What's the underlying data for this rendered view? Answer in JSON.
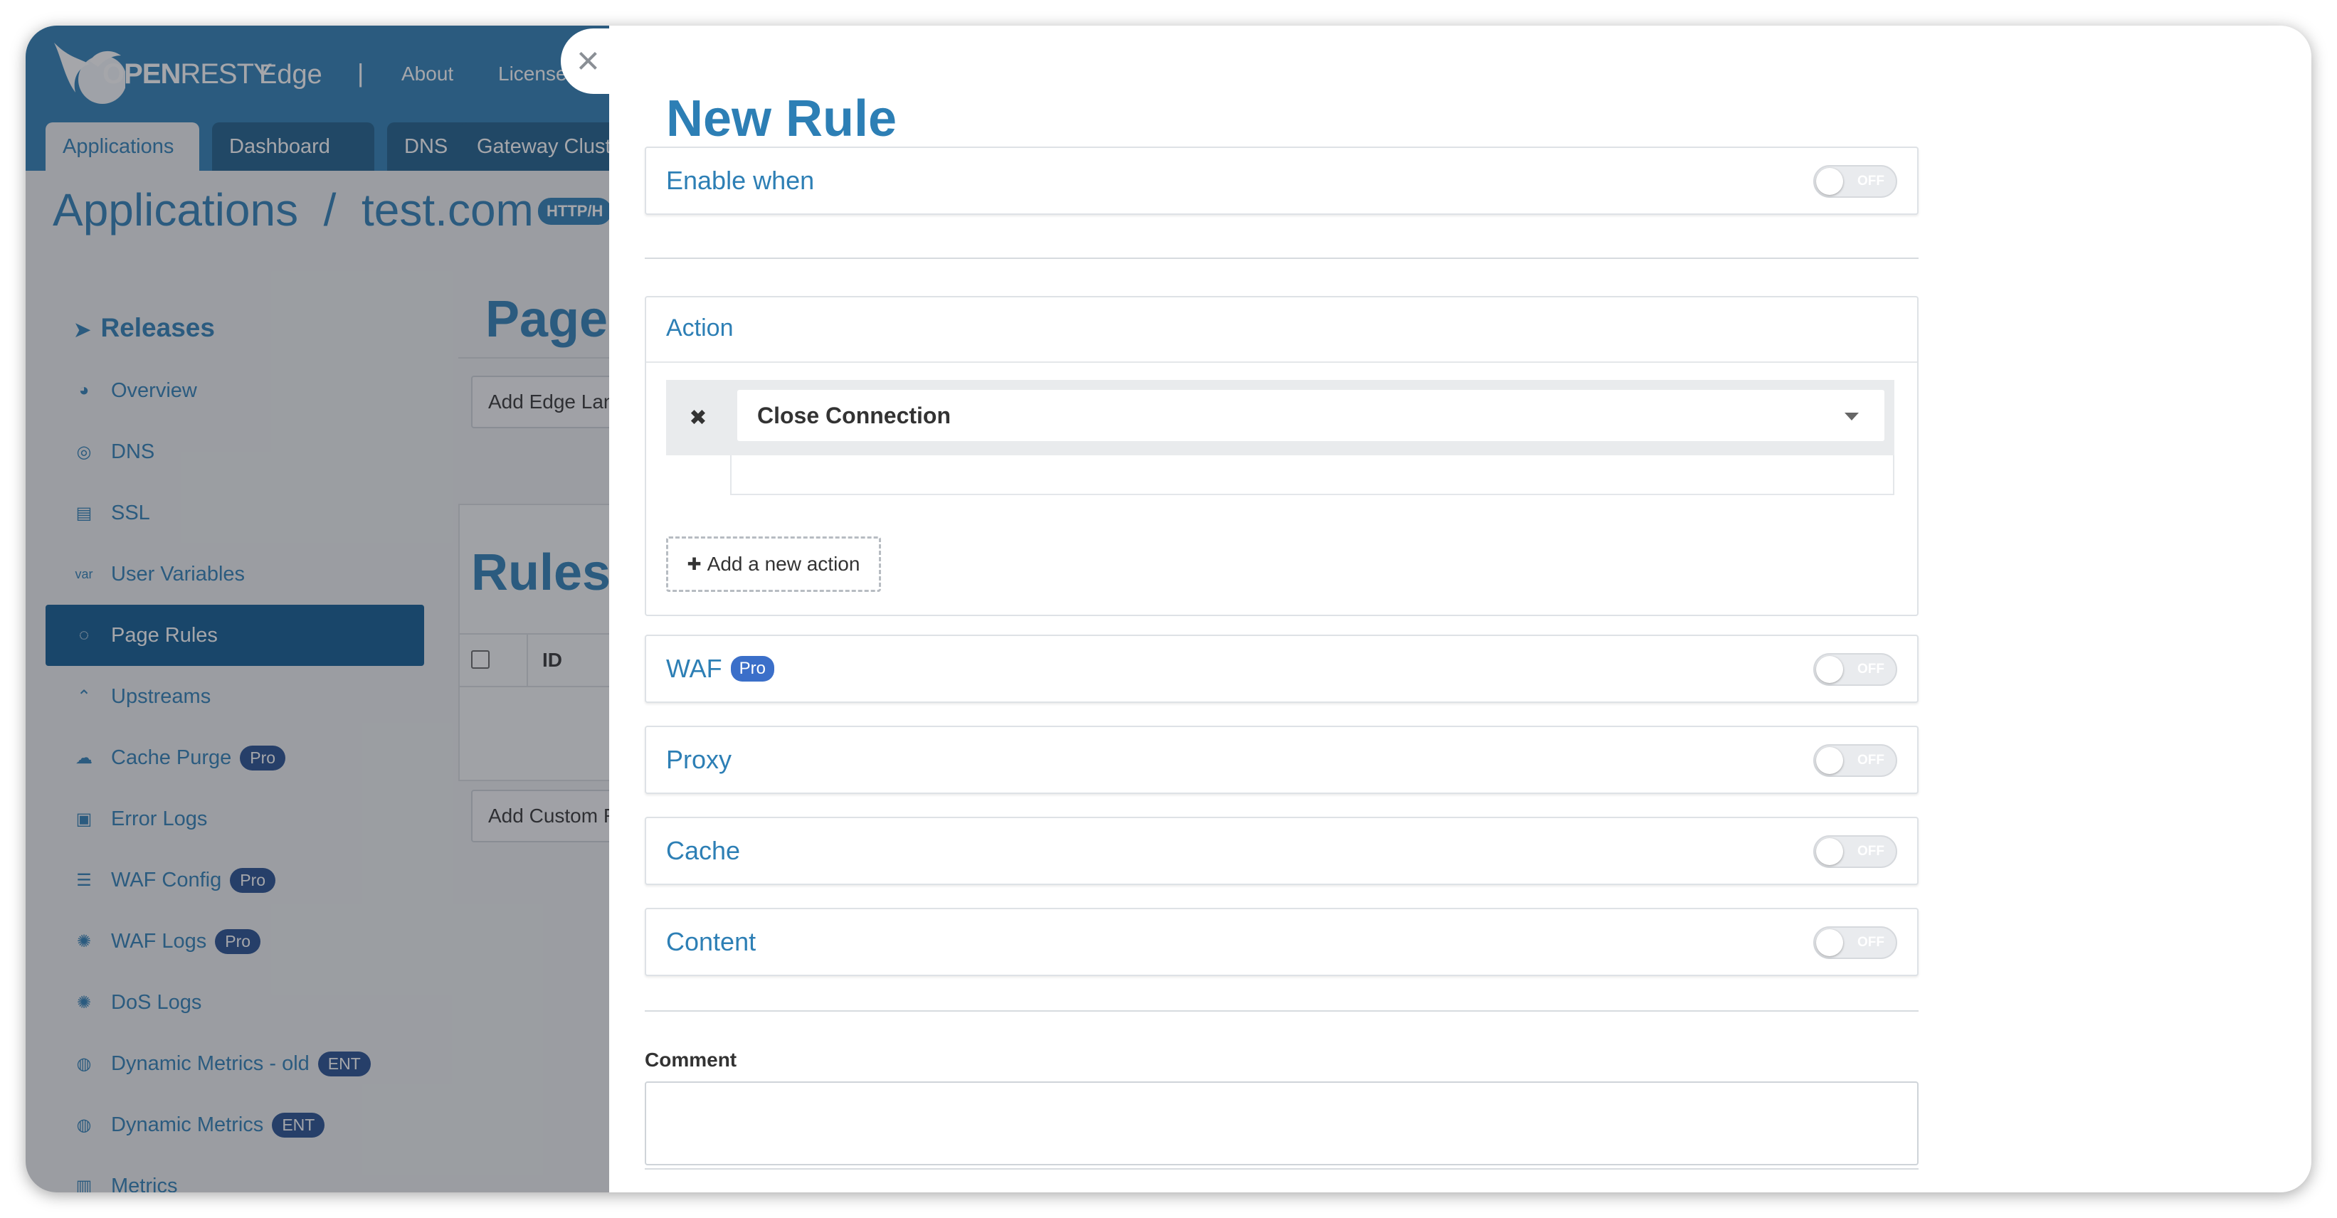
{
  "background": {
    "brand": {
      "open": "OPEN",
      "resty": "RESTY",
      "edge": "Edge"
    },
    "header_links": [
      "About",
      "License"
    ],
    "separator": "|",
    "tabs": [
      "Applications",
      "Dashboard",
      "DNS",
      "Gateway Clust"
    ],
    "page_title": "Applications  /  test.com",
    "protocol_badge": "HTTP/H",
    "sidebar": {
      "heading": "Releases",
      "items": [
        {
          "label": "Overview",
          "icon": "dashboard-icon",
          "badge": ""
        },
        {
          "label": "DNS",
          "icon": "globe-icon",
          "badge": ""
        },
        {
          "label": "SSL",
          "icon": "certificate-icon",
          "badge": ""
        },
        {
          "label": "User Variables",
          "icon": "var-icon",
          "badge": ""
        },
        {
          "label": "Page Rules",
          "icon": "rules-icon",
          "badge": ""
        },
        {
          "label": "Upstreams",
          "icon": "upstream-icon",
          "badge": ""
        },
        {
          "label": "Cache Purge",
          "icon": "cache-icon",
          "badge": "Pro"
        },
        {
          "label": "Error Logs",
          "icon": "log-icon",
          "badge": ""
        },
        {
          "label": "WAF Config",
          "icon": "list-icon",
          "badge": "Pro"
        },
        {
          "label": "WAF Logs",
          "icon": "bug-icon",
          "badge": "Pro"
        },
        {
          "label": "DoS Logs",
          "icon": "bug-icon",
          "badge": ""
        },
        {
          "label": "Dynamic Metrics - old",
          "icon": "metrics-icon",
          "badge": "ENT"
        },
        {
          "label": "Dynamic Metrics",
          "icon": "metrics-icon",
          "badge": "ENT"
        },
        {
          "label": "Metrics",
          "icon": "bar-chart-icon",
          "badge": ""
        }
      ]
    },
    "content": {
      "heading": "Page",
      "add_edge_button": "Add Edge Lan",
      "rules_heading": "Rules",
      "id_column": "ID",
      "add_custom_button": "Add Custom R"
    }
  },
  "modal": {
    "close_glyph": "×",
    "title": "New Rule",
    "enable_when": {
      "label": "Enable when",
      "toggle": "OFF"
    },
    "action": {
      "title": "Action",
      "remove_glyph": "✖",
      "selected": "Close Connection",
      "add_label": "Add a new action",
      "add_glyph": "✚"
    },
    "sections": [
      {
        "label": "WAF",
        "badge": "Pro",
        "toggle": "OFF"
      },
      {
        "label": "Proxy",
        "badge": "",
        "toggle": "OFF"
      },
      {
        "label": "Cache",
        "badge": "",
        "toggle": "OFF"
      },
      {
        "label": "Content",
        "badge": "",
        "toggle": "OFF"
      }
    ],
    "comment_label": "Comment",
    "comment_value": ""
  },
  "colors": {
    "primary": "#2d7fb5",
    "sidebar_active": "#0f5b92",
    "badge": "#254f8f",
    "pro_badge": "#3b6fc9"
  }
}
